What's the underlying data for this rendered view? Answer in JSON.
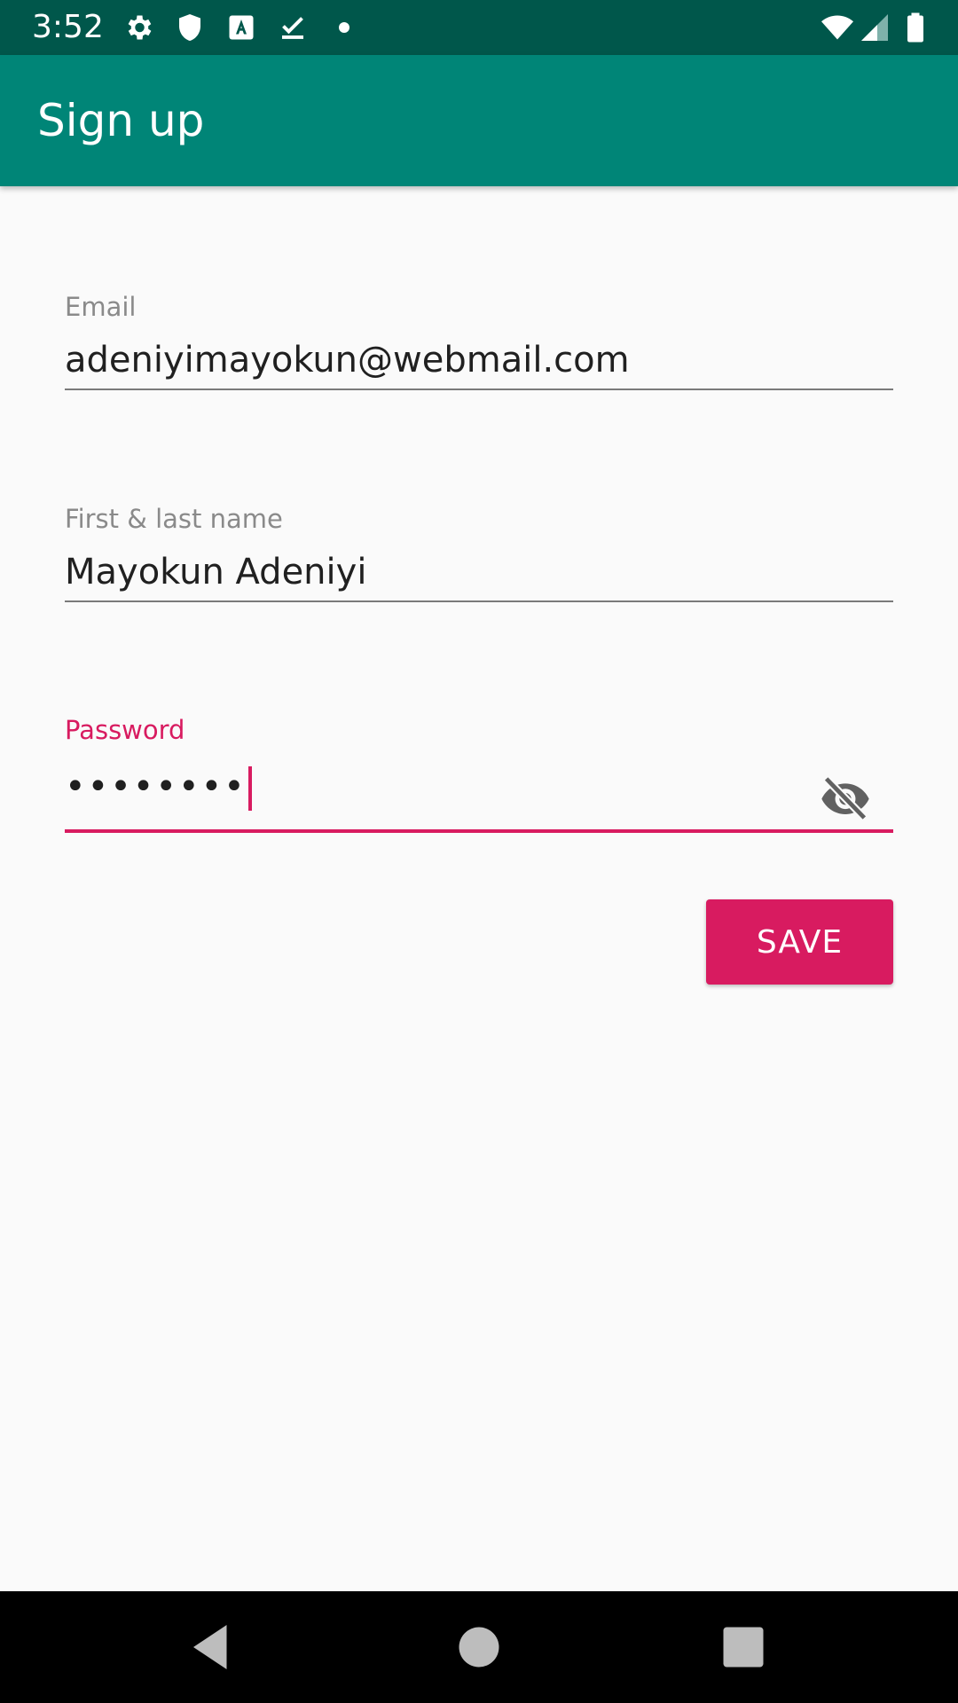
{
  "status_bar": {
    "time": "3:52",
    "icons": [
      "gear-icon",
      "shield-icon",
      "keyboard-a-icon",
      "download-done-icon",
      "dot-icon",
      "wifi-icon",
      "signal-icon",
      "battery-icon"
    ]
  },
  "app_bar": {
    "title": "Sign up"
  },
  "form": {
    "email": {
      "label": "Email",
      "value": "adeniyimayokun@webmail.com"
    },
    "name": {
      "label": "First & last name",
      "value": "Mayokun Adeniyi"
    },
    "password": {
      "label": "Password",
      "masked_value": "••••••••"
    },
    "save_label": "SAVE"
  },
  "colors": {
    "status_bar": "#00574b",
    "primary": "#008577",
    "accent": "#d81b60",
    "background": "#fafafa"
  },
  "nav_bar": {
    "icons": [
      "back-icon",
      "home-icon",
      "recents-icon"
    ]
  }
}
